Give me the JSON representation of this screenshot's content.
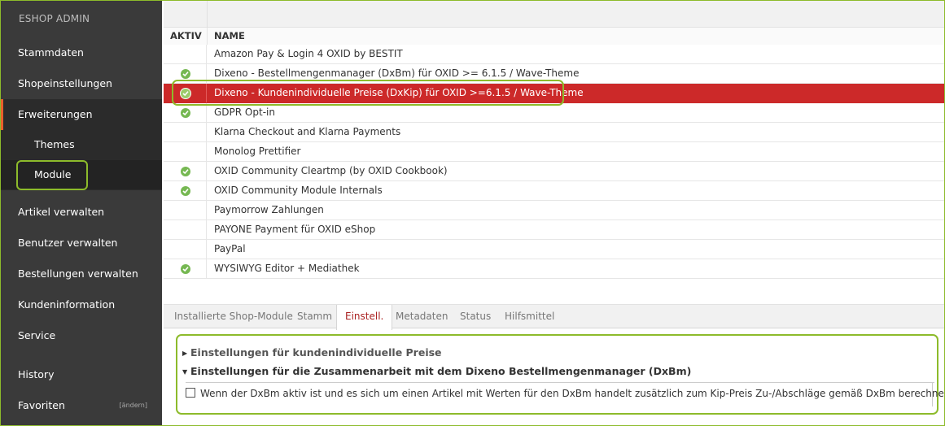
{
  "sidebar": {
    "brand": "ESHOP ADMIN",
    "items": [
      {
        "label": "Stammdaten"
      },
      {
        "label": "Shopeinstellungen"
      },
      {
        "label": "Erweiterungen"
      },
      {
        "label": "Artikel verwalten"
      },
      {
        "label": "Benutzer verwalten"
      },
      {
        "label": "Bestellungen verwalten"
      },
      {
        "label": "Kundeninformation"
      },
      {
        "label": "Service"
      },
      {
        "label": "History"
      },
      {
        "label": "Favoriten"
      }
    ],
    "submenu": [
      {
        "label": "Themes"
      },
      {
        "label": "Module"
      }
    ],
    "favoriten_action": "[ändern]"
  },
  "table": {
    "headers": {
      "aktiv": "AKTIV",
      "name": "NAME"
    },
    "rows": [
      {
        "name": "Amazon Pay & Login 4 OXID by BESTIT",
        "active": false
      },
      {
        "name": "Dixeno - Bestellmengenmanager (DxBm) für OXID >= 6.1.5 / Wave-Theme",
        "active": true
      },
      {
        "name": "Dixeno - Kundenindividuelle Preise (DxKip) für OXID >=6.1.5 / Wave-Theme",
        "active": true,
        "selected": true
      },
      {
        "name": "GDPR Opt-in",
        "active": true
      },
      {
        "name": "Klarna Checkout and Klarna Payments",
        "active": false
      },
      {
        "name": "Monolog Prettifier",
        "active": false
      },
      {
        "name": "OXID Community Cleartmp (by OXID Cookbook)",
        "active": true
      },
      {
        "name": "OXID Community Module Internals",
        "active": true
      },
      {
        "name": "Paymorrow Zahlungen",
        "active": false
      },
      {
        "name": "PAYONE Payment für OXID eShop",
        "active": false
      },
      {
        "name": "PayPal",
        "active": false
      },
      {
        "name": "WYSIWYG Editor + Mediathek",
        "active": true
      }
    ]
  },
  "tabs": [
    {
      "label": "Installierte Shop-Module"
    },
    {
      "label": "Stamm"
    },
    {
      "label": "Einstell.",
      "active": true
    },
    {
      "label": "Metadaten"
    },
    {
      "label": "Status"
    },
    {
      "label": "Hilfsmittel"
    }
  ],
  "settings": {
    "group1": "Einstellungen für kundenindividuelle Preise",
    "group2": "Einstellungen für die Zusammenarbeit mit dem Dixeno Bestellmengenmanager (DxBm)",
    "option1": "Wenn der DxBm aktiv ist und es sich um einen Artikel mit Werten für den DxBm handelt zusätzlich zum Kip-Preis Zu-/Abschläge gemäß DxBm berechnen.",
    "option1_checked": false
  },
  "colors": {
    "accent_green": "#8dbb2b",
    "selected_row": "#cc2929",
    "sidebar_bg": "#3a3a3a",
    "active_check": "#76b852"
  },
  "icons": {
    "active": "check-circle-icon",
    "collapsed": "triangle-right-icon",
    "expanded": "triangle-down-icon"
  }
}
